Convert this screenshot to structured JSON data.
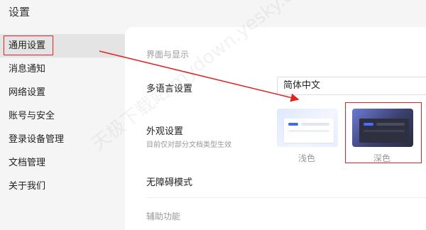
{
  "window": {
    "title": "设置"
  },
  "sidebar": {
    "items": [
      {
        "label": "通用设置",
        "active": true
      },
      {
        "label": "消息通知"
      },
      {
        "label": "网络设置"
      },
      {
        "label": "账号与安全"
      },
      {
        "label": "登录设备管理"
      },
      {
        "label": "文档管理"
      },
      {
        "label": "关于我们"
      }
    ]
  },
  "main": {
    "section_interface": "界面与显示",
    "language": {
      "label": "多语言设置",
      "value": "简体中文"
    },
    "appearance": {
      "label": "外观设置",
      "sublabel": "目前仅对部分文档类型生效",
      "options": [
        {
          "label": "浅色"
        },
        {
          "label": "深色",
          "selected": true
        }
      ]
    },
    "accessibility_mode": {
      "label": "无障碍模式"
    },
    "section_assist": "辅助功能"
  },
  "annotation_color": "#e02424",
  "watermark": "天极下载站 mydown.yesky.com"
}
